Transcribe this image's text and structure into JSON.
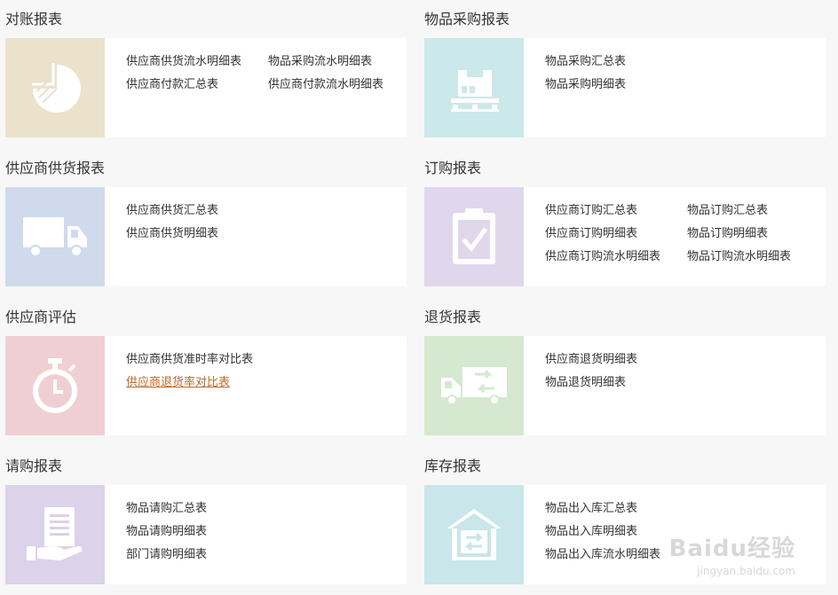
{
  "colors": {
    "page_bg": "#f7f7f7",
    "card_bg": "#ffffff",
    "link_active": "#c06a2b"
  },
  "sections": [
    {
      "title": "对账报表",
      "icon": "pie-chart-icon",
      "tile_color": "#ebe2cc",
      "links": [
        "供应商供货流水明细表",
        "物品采购流水明细表",
        "供应商付款汇总表",
        "供应商付款流水明细表"
      ]
    },
    {
      "title": "物品采购报表",
      "icon": "boxes-on-pallet-icon",
      "tile_color": "#cbe8ea",
      "links": [
        "物品采购汇总表",
        "物品采购明细表"
      ]
    },
    {
      "title": "供应商供货报表",
      "icon": "truck-icon",
      "tile_color": "#cfdaec",
      "links": [
        "供应商供货汇总表",
        "供应商供货明细表"
      ]
    },
    {
      "title": "订购报表",
      "icon": "clipboard-check-icon",
      "tile_color": "#e0d7ec",
      "links": [
        "供应商订购汇总表",
        "物品订购汇总表",
        "供应商订购明细表",
        "物品订购明细表",
        "供应商订购流水明细表",
        "物品订购流水明细表"
      ]
    },
    {
      "title": "供应商评估",
      "icon": "stopwatch-icon",
      "tile_color": "#f0cfd2",
      "links": [
        "供应商供货准时率对比表",
        "供应商退货率对比表"
      ],
      "active_link": "供应商退货率对比表"
    },
    {
      "title": "退货报表",
      "icon": "return-truck-icon",
      "tile_color": "#d4e9cf",
      "links": [
        "供应商退货明细表",
        "物品退货明细表"
      ]
    },
    {
      "title": "请购报表",
      "icon": "hand-document-icon",
      "tile_color": "#dcd2ea",
      "links": [
        "物品请购汇总表",
        "物品请购明细表",
        "部门请购明细表"
      ]
    },
    {
      "title": "库存报表",
      "icon": "warehouse-icon",
      "tile_color": "#c9e6ea",
      "links": [
        "物品出入库汇总表",
        "物品出入库明细表",
        "物品出入库流水明细表"
      ]
    }
  ],
  "watermark": {
    "logo": "Baidu经验",
    "url": "jingyan.baidu.com"
  }
}
